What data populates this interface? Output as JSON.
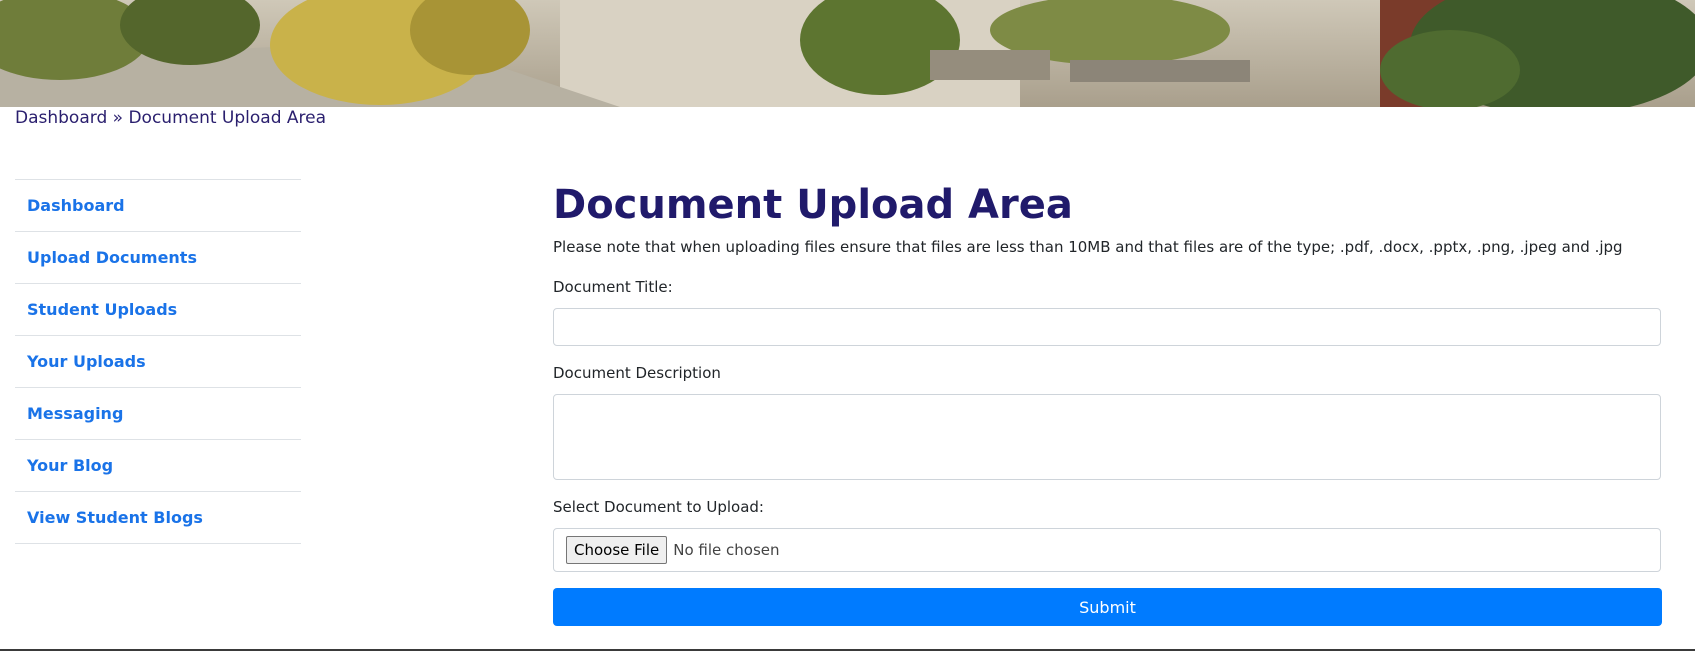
{
  "banner": {
    "alt": "campus plaza photo"
  },
  "breadcrumb": {
    "home": "Dashboard",
    "separator": " » ",
    "current": "Document Upload Area"
  },
  "sidebar": {
    "items": [
      {
        "label": "Dashboard"
      },
      {
        "label": "Upload Documents"
      },
      {
        "label": "Student Uploads"
      },
      {
        "label": "Your Uploads"
      },
      {
        "label": "Messaging"
      },
      {
        "label": "Your Blog"
      },
      {
        "label": "View Student Blogs"
      }
    ]
  },
  "main": {
    "title": "Document Upload Area",
    "note": "Please note that when uploading files ensure that files are less than 10MB and that files are of the type; .pdf, .docx, .pptx, .png, .jpeg and .jpg",
    "title_label": "Document Title:",
    "title_value": "",
    "description_label": "Document Description",
    "description_value": "",
    "file_label": "Select Document to Upload:",
    "choose_file": "Choose File",
    "no_file": "No file chosen",
    "submit": "Submit"
  },
  "colors": {
    "heading": "#201a6b",
    "link": "#1a73e8",
    "primary": "#007bff",
    "border": "#dee2e6"
  }
}
